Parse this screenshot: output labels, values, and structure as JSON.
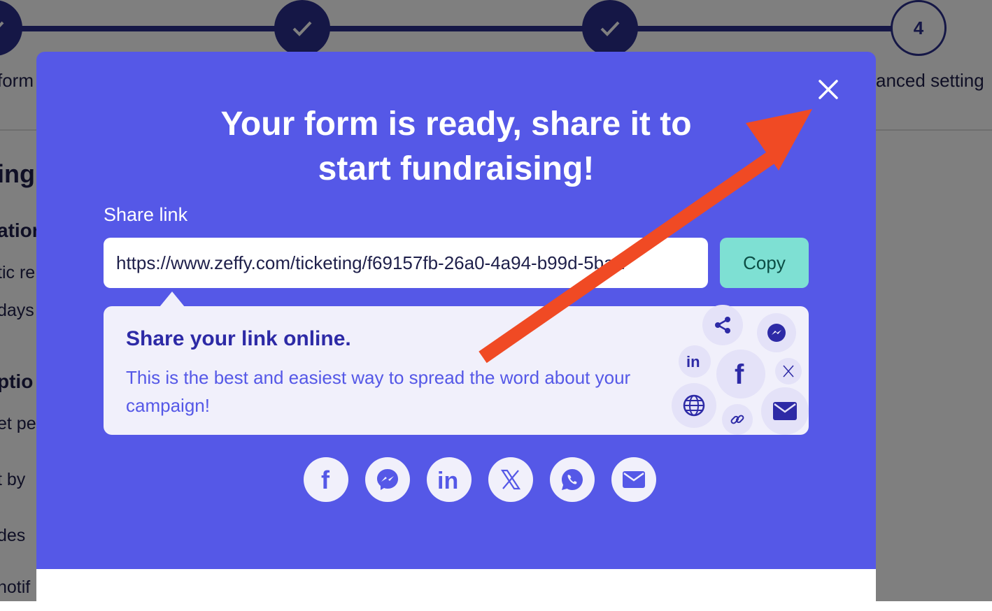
{
  "stepper": {
    "step4_number": "4",
    "labels": {
      "first": "form",
      "last": "anced setting"
    }
  },
  "background": {
    "lines": [
      "ing",
      "ation",
      "tic re",
      "days",
      "ptio",
      "et pe",
      "t by",
      "des",
      "notif"
    ]
  },
  "modal": {
    "title_line1": "Your form is ready, share it to",
    "title_line2": "start fundraising!",
    "share_label": "Share link",
    "share_link_value": "https://www.zeffy.com/ticketing/f69157fb-26a0-4a94-b99d-5baa",
    "copy_label": "Copy",
    "card": {
      "title": "Share your link online.",
      "text": "This is the best and easiest way to spread the word about your campaign!"
    },
    "social_buttons": [
      "facebook-icon",
      "messenger-icon",
      "linkedin-icon",
      "x-icon",
      "whatsapp-icon",
      "email-icon"
    ],
    "colors": {
      "modal_bg": "#5558e7",
      "copy_bg": "#7ee0d3",
      "card_bg": "#f1f0fb",
      "arrow": "#f04a24"
    }
  }
}
